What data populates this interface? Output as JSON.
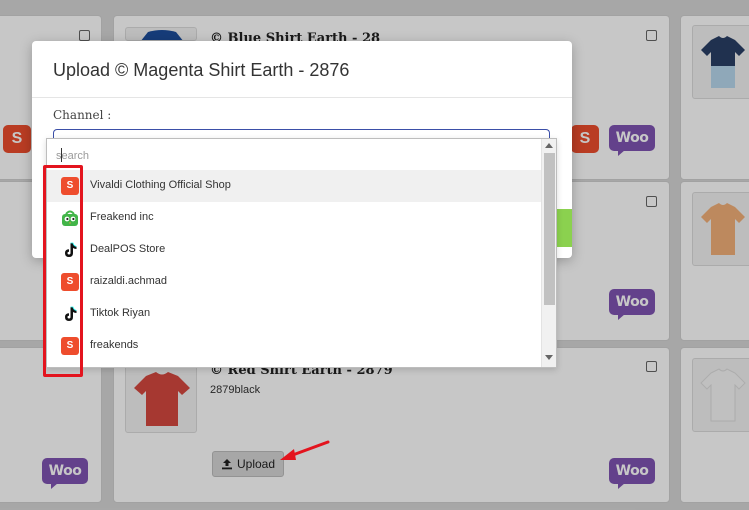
{
  "modal": {
    "title": "Upload © Magenta Shirt Earth - 2876",
    "channel_label": "Channel :"
  },
  "dropdown": {
    "search_placeholder": "search",
    "options": [
      {
        "label": "Vivaldi Clothing Official Shop",
        "icon": "shopee-icon"
      },
      {
        "label": "Freakend inc",
        "icon": "tokopedia-icon"
      },
      {
        "label": "DealPOS Store",
        "icon": "tiktok-icon"
      },
      {
        "label": "raizaldi.achmad",
        "icon": "shopee-icon"
      },
      {
        "label": "Tiktok Riyan",
        "icon": "tiktok-icon"
      },
      {
        "label": "freakends",
        "icon": "shopee-icon"
      }
    ]
  },
  "background": {
    "products": [
      {
        "title": "© Blue Shirt Earth - 28"
      },
      {
        "title": "© Red Shirt Earth - 2879",
        "sku": "2879black"
      }
    ],
    "woo_label": "Woo",
    "shopee_glyph": "S",
    "upload_label": "Upload"
  },
  "colors": {
    "woo_purple": "#7f54b3",
    "shopee_orange": "#ee4d2d",
    "annotation_red": "#e3141e",
    "select_border": "#3b4fa8"
  }
}
